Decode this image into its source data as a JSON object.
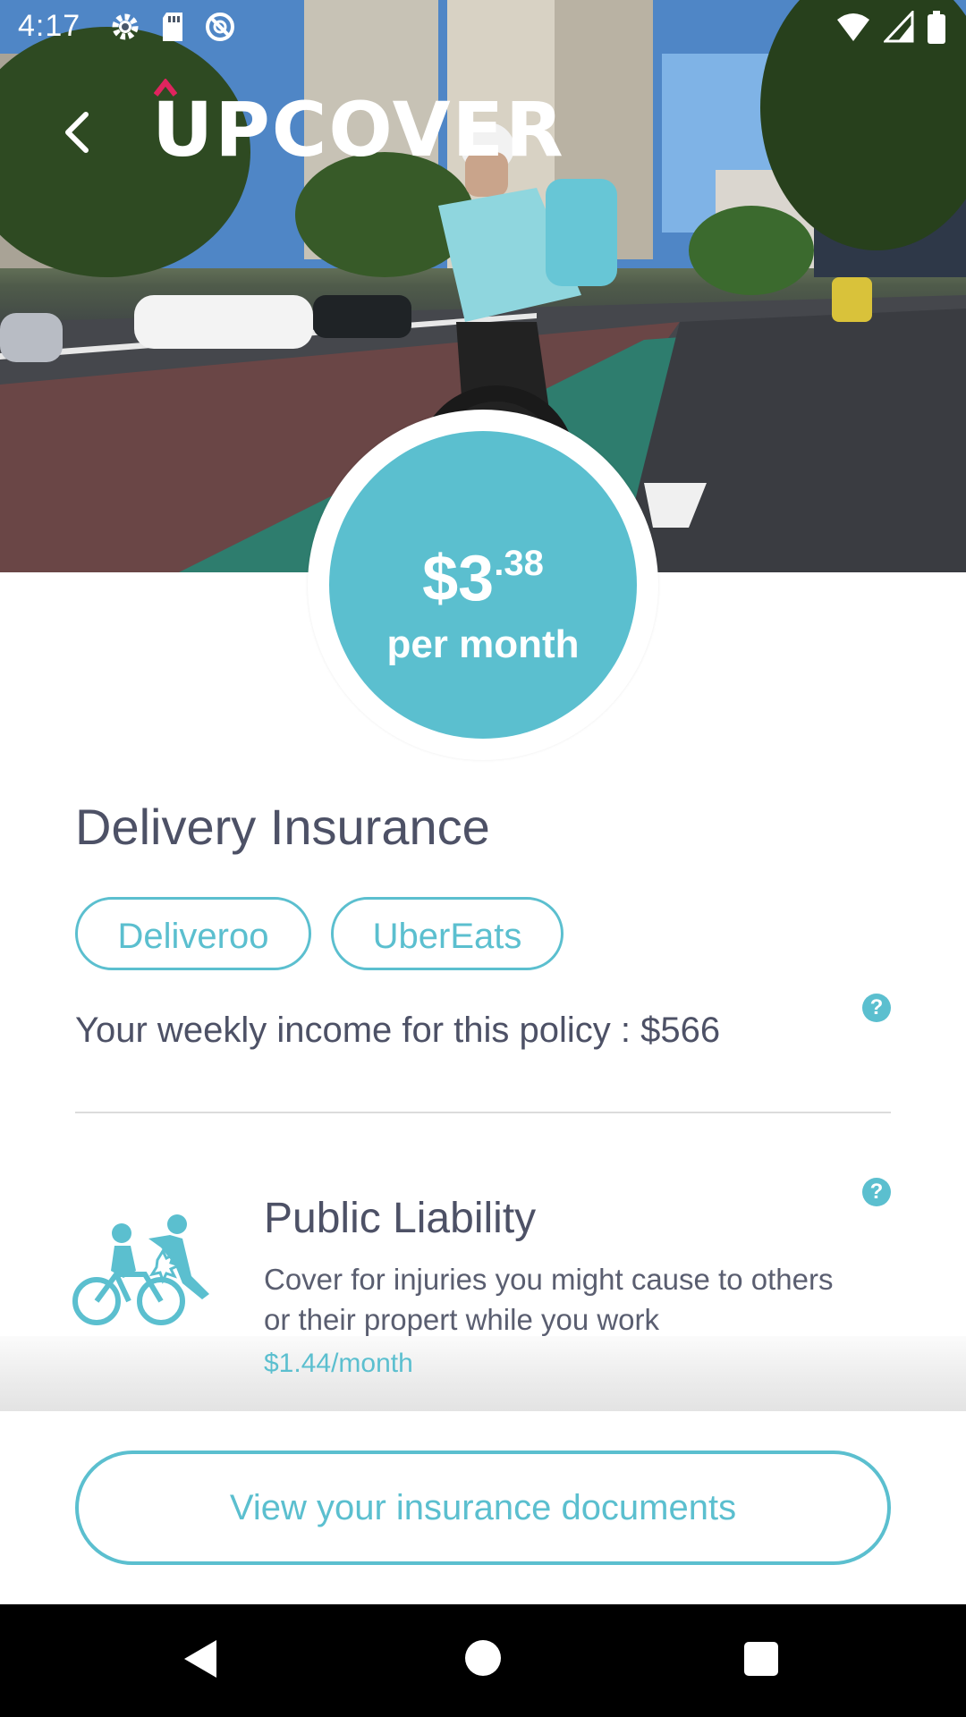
{
  "status_bar": {
    "time": "4:17",
    "left_icons": [
      "settings-icon",
      "sd-card-icon",
      "no-sim-icon"
    ],
    "right_icons": [
      "wifi-icon",
      "signal-icon",
      "battery-icon"
    ]
  },
  "header": {
    "logo_text": "UPCOVER",
    "back_icon": "chevron-left-icon"
  },
  "price": {
    "dollars": "$3",
    "cents": ".38",
    "period": "per month"
  },
  "policy": {
    "title": "Delivery Insurance",
    "platforms": [
      "Deliveroo",
      "UberEats"
    ],
    "income_text": "Your weekly income for this policy : $566"
  },
  "coverage": {
    "title": "Public Liability",
    "description": "Cover for injuries you might cause to others or their propert while you work",
    "price": "$1.44/month",
    "icon": "cyclist-collision-icon"
  },
  "actions": {
    "documents_label": "View your insurance documents"
  },
  "nav": {
    "icons": [
      "back-triangle-icon",
      "home-circle-icon",
      "recents-square-icon"
    ]
  },
  "colors": {
    "accent": "#5bbfcf",
    "text": "#4d5166",
    "navbar": "#000000"
  }
}
